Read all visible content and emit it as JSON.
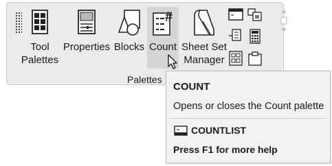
{
  "ribbon_panel": {
    "title": "Palettes",
    "buttons": [
      {
        "id": "tool-palettes",
        "label": "Tool\nPalettes",
        "icon": "tool-palettes-icon"
      },
      {
        "id": "properties",
        "label": "Properties",
        "icon": "properties-icon"
      },
      {
        "id": "blocks",
        "label": "Blocks",
        "icon": "blocks-icon"
      },
      {
        "id": "count",
        "label": "Count",
        "icon": "count-icon",
        "state": "hovered"
      },
      {
        "id": "sheet-set-manager",
        "label": "Sheet Set\nManager",
        "icon": "sheet-set-manager-icon"
      }
    ],
    "small_buttons": [
      "command-line-icon",
      "design-center-icon",
      "external-references-icon",
      "quickcalc-icon",
      "markup-set-manager-icon",
      "tool-palette-clipboard-icon"
    ]
  },
  "tooltip": {
    "title": "COUNT",
    "description": "Opens or closes the Count palette",
    "command": "COUNTLIST",
    "help": "Press F1 for more help"
  },
  "colors": {
    "panel_bg": "#ebebeb",
    "hover_bg": "#d6d6d6",
    "tooltip_bg": "#f2f2f2",
    "text": "#1a1a1a"
  }
}
